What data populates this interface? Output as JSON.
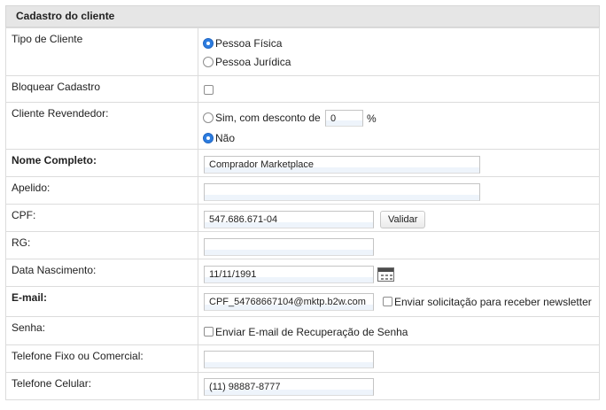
{
  "section_title": "Cadastro do cliente",
  "fields": {
    "tipo_cliente": {
      "label": "Tipo de Cliente",
      "options": [
        "Pessoa Física",
        "Pessoa Jurídica"
      ],
      "selected": "Pessoa Física"
    },
    "bloquear": {
      "label": "Bloquear Cadastro",
      "checked": false
    },
    "revendedor": {
      "label": "Cliente Revendedor:",
      "option_sim": "Sim, com desconto de",
      "discount_value": "0",
      "percent_sign": "%",
      "option_nao": "Não",
      "selected": "Não"
    },
    "nome": {
      "label": "Nome Completo:",
      "value": "Comprador Marketplace"
    },
    "apelido": {
      "label": "Apelido:",
      "value": ""
    },
    "cpf": {
      "label": "CPF:",
      "value": "547.686.671-04",
      "validate_button": "Validar"
    },
    "rg": {
      "label": "RG:",
      "value": ""
    },
    "nascimento": {
      "label": "Data Nascimento:",
      "value": "11/11/1991",
      "icon": "calendar-icon"
    },
    "email": {
      "label": "E-mail:",
      "value": "CPF_54768667104@mktp.b2w.com",
      "newsletter_label": "Enviar solicitação para receber newsletter",
      "newsletter_checked": false
    },
    "senha": {
      "label": "Senha:",
      "recovery_label": "Enviar E-mail de Recuperação de Senha",
      "recovery_checked": false
    },
    "telefone_fixo": {
      "label": "Telefone Fixo ou Comercial:",
      "value": ""
    },
    "telefone_celular": {
      "label": "Telefone Celular:",
      "value": "(11) 98887-8777"
    }
  }
}
